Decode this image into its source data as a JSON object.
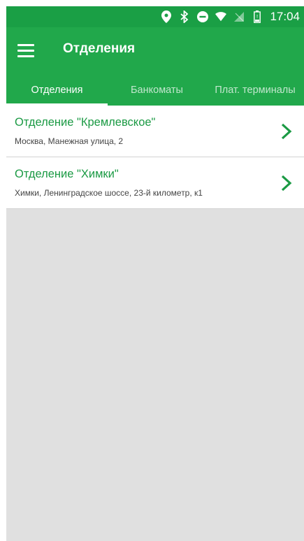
{
  "status_bar": {
    "time": "17:04",
    "icons": [
      "location-icon",
      "bluetooth-icon",
      "do-not-disturb-icon",
      "wifi-icon",
      "no-sim-icon",
      "battery-icon"
    ]
  },
  "app_bar": {
    "title": "Отделения"
  },
  "tabs": [
    {
      "label": "Отделения",
      "active": true
    },
    {
      "label": "Банкоматы",
      "active": false
    },
    {
      "label": "Плат. терминалы",
      "active": false
    }
  ],
  "branches": [
    {
      "name": "Отделение \"Кремлевское\"",
      "address": "Москва, Манежная улица, 2"
    },
    {
      "name": "Отделение \"Химки\"",
      "address": "Химки, Ленинградское шоссе, 23-й километр, к1"
    }
  ],
  "colors": {
    "primary": "#21a84b",
    "status_bar": "#1a9f45",
    "accent_text": "#1b9a44",
    "background": "#e0e0e0"
  }
}
